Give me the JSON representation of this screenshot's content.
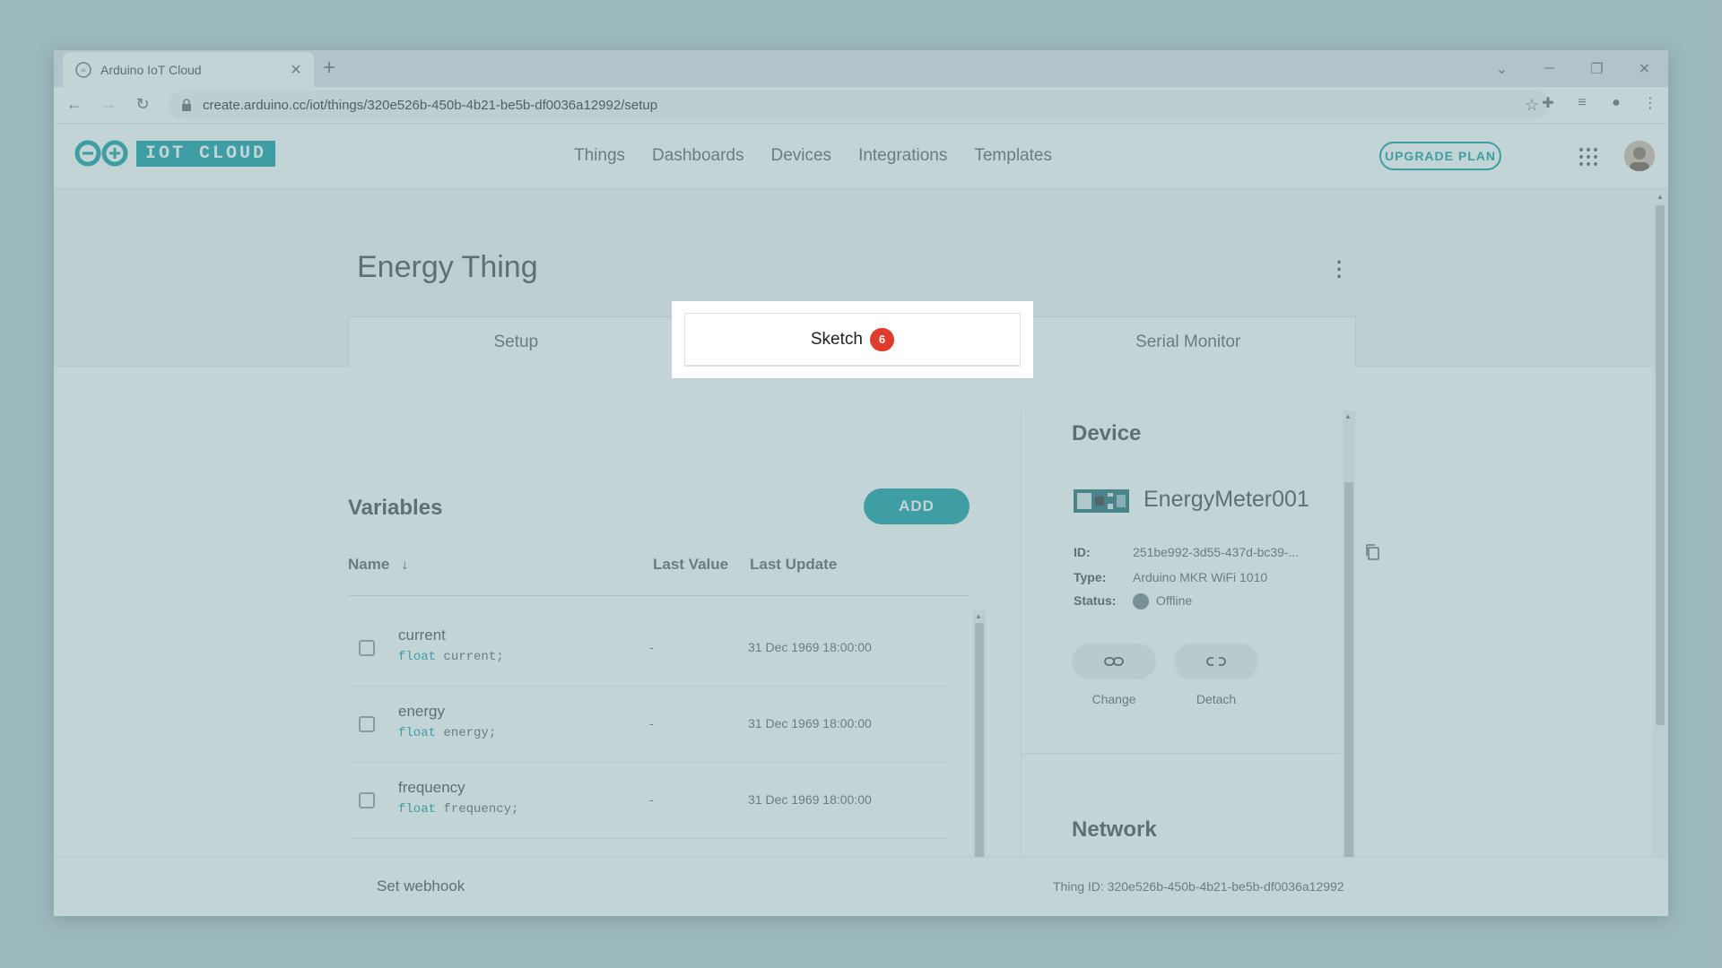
{
  "browser": {
    "tab_title": "Arduino IoT Cloud",
    "tab_close": "✕",
    "new_tab": "+",
    "url": "create.arduino.cc/iot/things/320e526b-450b-4b21-be5b-df0036a12992/setup"
  },
  "header": {
    "brand": "IOT CLOUD",
    "nav": [
      "Things",
      "Dashboards",
      "Devices",
      "Integrations",
      "Templates"
    ],
    "upgrade_label": "UPGRADE PLAN"
  },
  "thing": {
    "title": "Energy Thing",
    "tabs": [
      {
        "label": "Setup"
      },
      {
        "label": "Sketch",
        "badge": "6"
      },
      {
        "label": "Serial Monitor"
      }
    ]
  },
  "variables": {
    "title": "Variables",
    "add_label": "ADD",
    "columns": {
      "name": "Name",
      "last_value": "Last Value",
      "last_update": "Last Update"
    },
    "rows": [
      {
        "name": "current",
        "type": "float",
        "decl": " current;",
        "value": "-",
        "updated": "31 Dec 1969 18:00:00"
      },
      {
        "name": "energy",
        "type": "float",
        "decl": " energy;",
        "value": "-",
        "updated": "31 Dec 1969 18:00:00"
      },
      {
        "name": "frequency",
        "type": "float",
        "decl": " frequency;",
        "value": "-",
        "updated": "31 Dec 1969 18:00:00"
      }
    ]
  },
  "device": {
    "title": "Device",
    "name": "EnergyMeter001",
    "id_label": "ID:",
    "id": "251be992-3d55-437d-bc39-...",
    "type_label": "Type:",
    "type": "Arduino MKR WiFi 1010",
    "status_label": "Status:",
    "status": "Offline",
    "change_label": "Change",
    "detach_label": "Detach"
  },
  "network": {
    "title": "Network"
  },
  "footer": {
    "webhook": "Set webhook",
    "thing_id": "Thing ID:  320e526b-450b-4b21-be5b-df0036a12992"
  },
  "colors": {
    "accent": "#00979d",
    "badge": "#e03b2b"
  }
}
